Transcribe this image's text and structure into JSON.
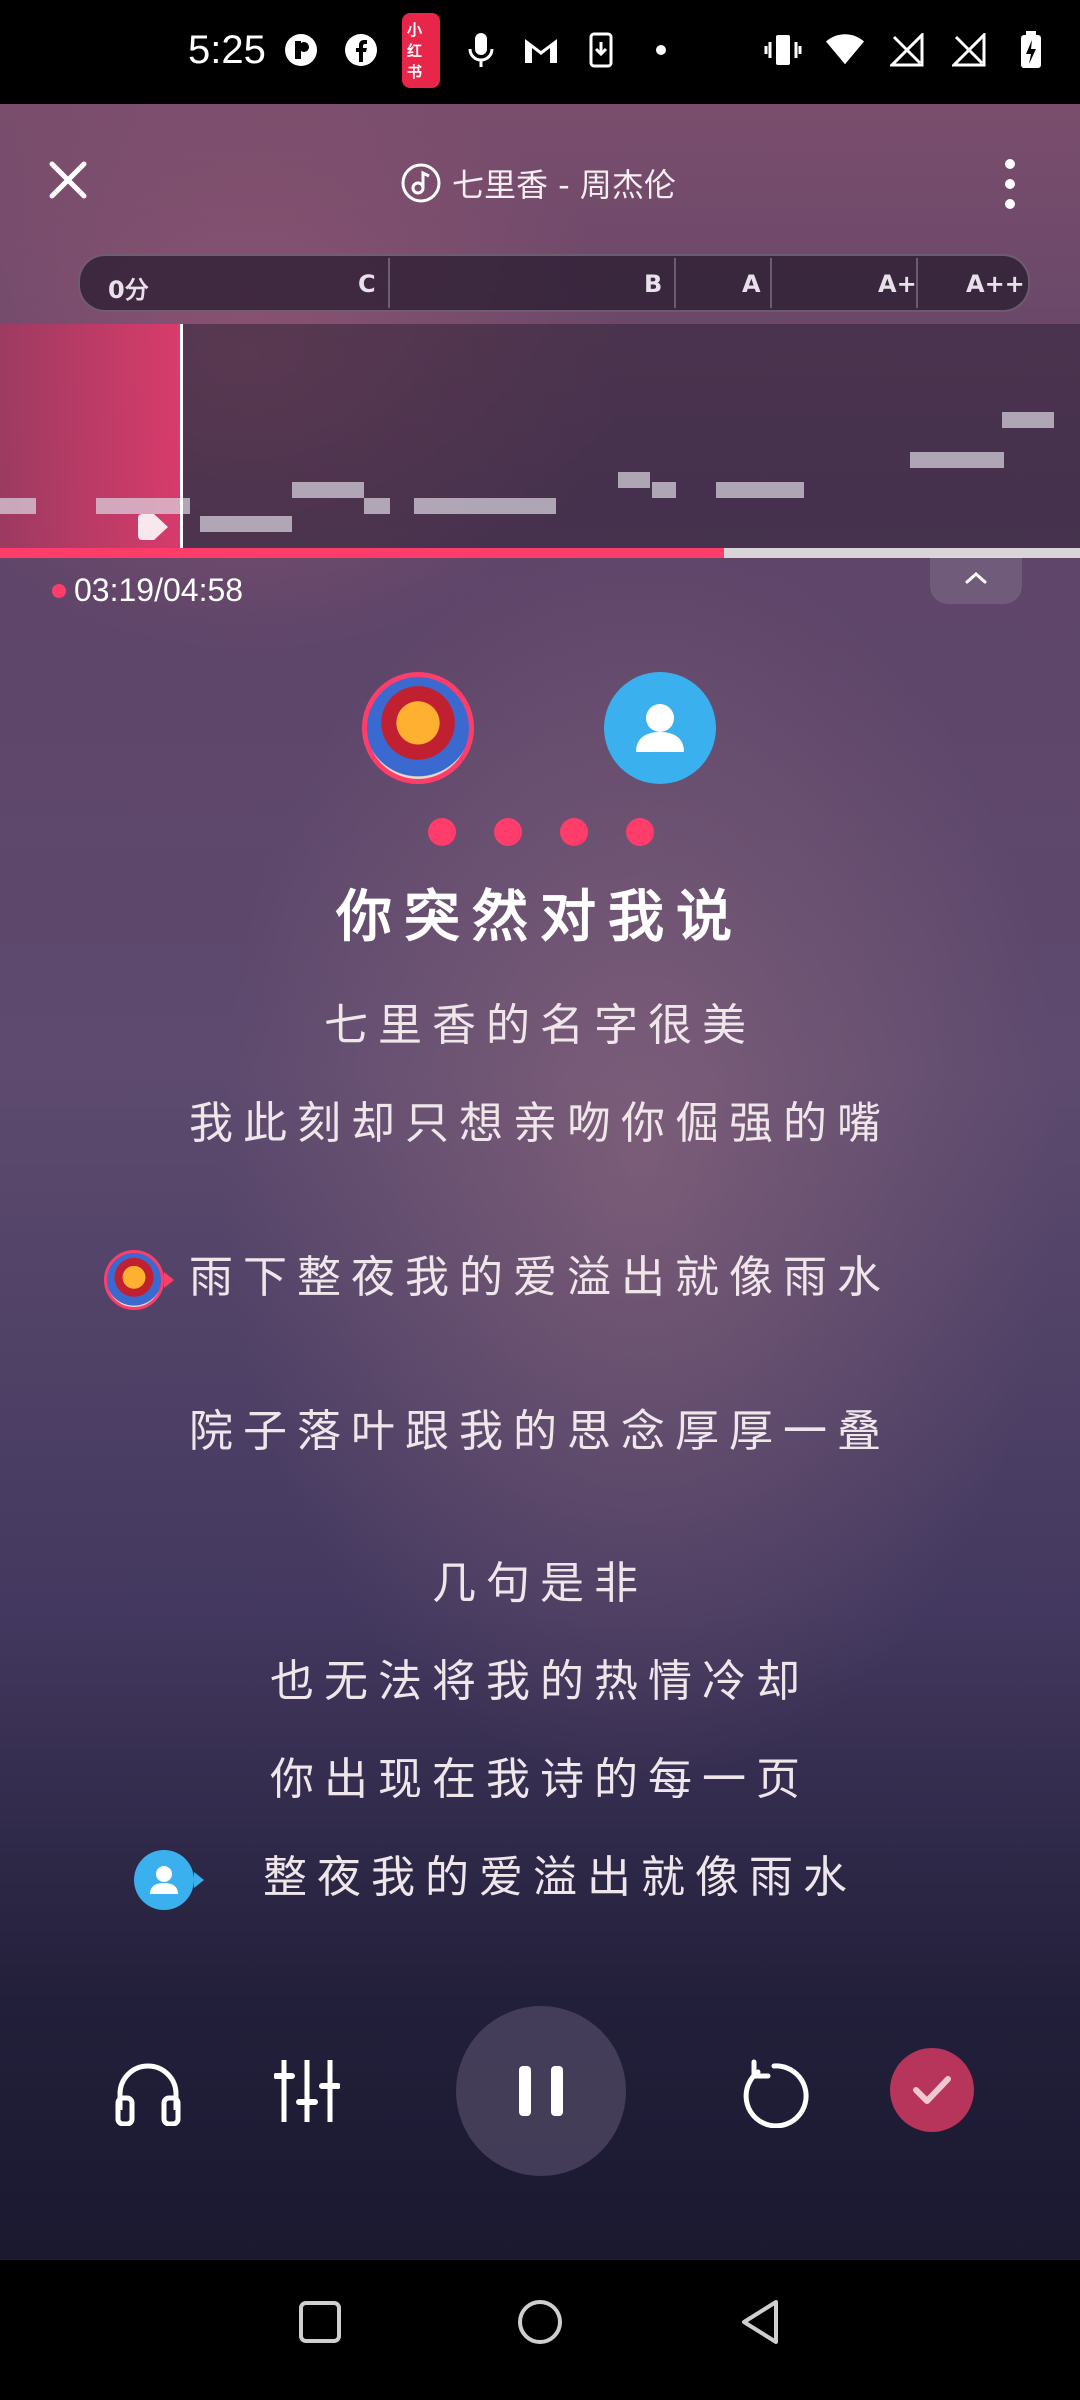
{
  "status_bar": {
    "time": "5:25",
    "badge": "小红书",
    "icons_left": [
      "p-app-icon",
      "facebook-icon",
      "xiaohongshu-icon",
      "mic-icon",
      "gmail-icon",
      "download-icon",
      "dot-icon"
    ],
    "icons_right": [
      "vibrate-icon",
      "wifi-icon",
      "no-signal-icon",
      "no-signal-icon",
      "battery-charging-icon"
    ]
  },
  "header": {
    "song_title": "七里香 - 周杰伦"
  },
  "score_bar": {
    "labels": [
      "0分",
      "C",
      "B",
      "A",
      "A+",
      "A++"
    ]
  },
  "progress": {
    "time": "03:19/04:58",
    "fraction": 0.67
  },
  "lyrics": {
    "current": "你突然对我说",
    "lines": [
      "七里香的名字很美",
      "我此刻却只想亲吻你倔强的嘴",
      "雨下整夜我的爱溢出就像雨水",
      "院子落叶跟我的思念厚厚一叠",
      "几句是非",
      "也无法将我的热情冷却",
      "你出现在我诗的每一页",
      "整夜我的爱溢出就像雨水"
    ]
  },
  "colors": {
    "accent": "#ff3d6a",
    "singer2": "#3ab0ee",
    "done": "#b7345a"
  },
  "controls": [
    "headphones-icon",
    "equalizer-icon",
    "pause-icon",
    "restart-icon",
    "check-icon"
  ]
}
